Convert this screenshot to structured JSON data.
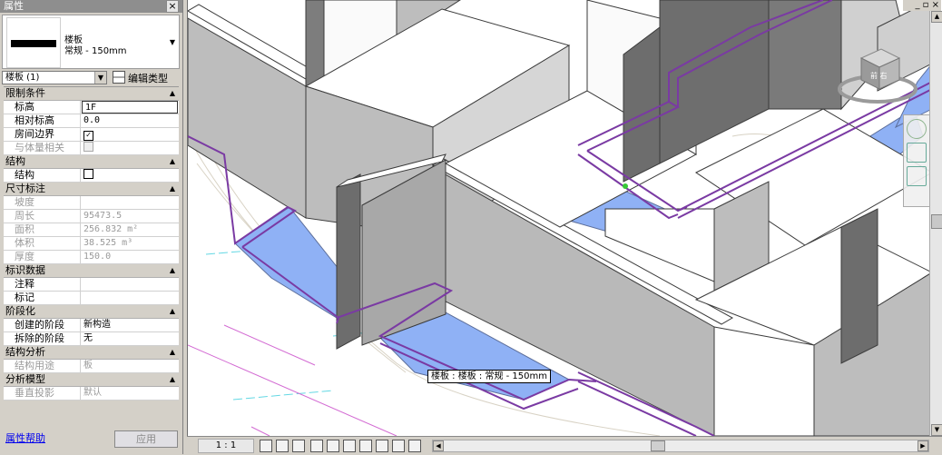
{
  "properties": {
    "title": "属性",
    "close": "×",
    "type_selector": {
      "family": "楼板",
      "type": "常规 - 150mm"
    },
    "instance_selector": "楼板 (1)",
    "edit_type_label": "编辑类型",
    "sections": [
      {
        "name": "限制条件",
        "rows": [
          {
            "key": "标高",
            "value": "1F",
            "kind": "edit"
          },
          {
            "key": "相对标高",
            "value": "0.0",
            "kind": "text"
          },
          {
            "key": "房间边界",
            "value": "✓",
            "kind": "check"
          },
          {
            "key": "与体量相关",
            "value": "",
            "kind": "check-dim"
          }
        ]
      },
      {
        "name": "结构",
        "rows": [
          {
            "key": "结构",
            "value": "",
            "kind": "check"
          }
        ]
      },
      {
        "name": "尺寸标注",
        "rows": [
          {
            "key": "坡度",
            "value": "",
            "kind": "dim"
          },
          {
            "key": "周长",
            "value": "95473.5",
            "kind": "dim"
          },
          {
            "key": "面积",
            "value": "256.832 m²",
            "kind": "dim"
          },
          {
            "key": "体积",
            "value": "38.525 m³",
            "kind": "dim"
          },
          {
            "key": "厚度",
            "value": "150.0",
            "kind": "dim"
          }
        ]
      },
      {
        "name": "标识数据",
        "rows": [
          {
            "key": "注释",
            "value": "",
            "kind": "text"
          },
          {
            "key": "标记",
            "value": "",
            "kind": "text"
          }
        ]
      },
      {
        "name": "阶段化",
        "rows": [
          {
            "key": "创建的阶段",
            "value": "新构造",
            "kind": "text"
          },
          {
            "key": "拆除的阶段",
            "value": "无",
            "kind": "text"
          }
        ]
      },
      {
        "name": "结构分析",
        "rows": [
          {
            "key": "结构用途",
            "value": "板",
            "kind": "dim"
          }
        ]
      },
      {
        "name": "分析模型",
        "rows": [
          {
            "key": "垂直投影",
            "value": "默认",
            "kind": "dim"
          }
        ]
      }
    ],
    "help_link": "属性帮助",
    "apply_button": "应用"
  },
  "viewport": {
    "tooltip": "楼板 : 楼板 : 常规 - 150mm",
    "window_controls": "_ ▫ ×",
    "viewcube_label": "前 右",
    "colors": {
      "slab": "#8fb1f5",
      "wall_front": "#bdbdbd",
      "wall_side": "#7d7d7d",
      "selection": "#7a3aa3"
    }
  },
  "view_control_bar": {
    "scale": "1 : 1"
  }
}
